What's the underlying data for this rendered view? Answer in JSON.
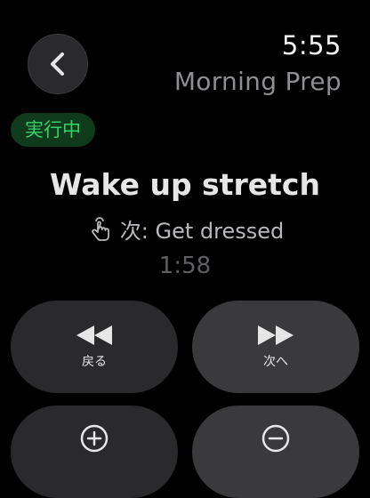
{
  "header": {
    "time": "5:55",
    "app_title": "Morning Prep"
  },
  "status": {
    "badge": "実行中",
    "badge_color": "#33d36a"
  },
  "task": {
    "title": "Wake up stretch",
    "next_label": "次: Get dressed",
    "remaining": "1:58"
  },
  "controls": {
    "previous_label": "戻る",
    "next_label": "次へ"
  },
  "icons": [
    "chevron-left-icon",
    "tap-hand-icon",
    "rewind-icon",
    "fast-forward-icon",
    "plus-circle-icon",
    "minus-circle-icon"
  ]
}
